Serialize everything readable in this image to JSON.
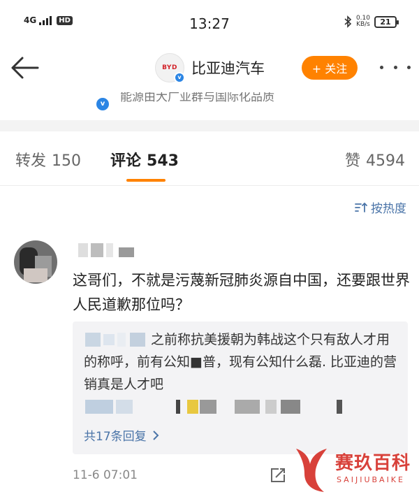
{
  "status_bar": {
    "network": "4G",
    "hd_label": "HD",
    "time": "13:27",
    "speed_value": "0.10",
    "speed_unit": "KB/s",
    "battery": "21"
  },
  "nav": {
    "brand_logo_text": "BYD",
    "brand_name": "比亚迪汽车",
    "follow_label": "+ 关注",
    "verified_mark": "v"
  },
  "cutoff": {
    "text": "能源由大广亚群与国际化品质"
  },
  "tabs": [
    {
      "label": "转发",
      "count": "150"
    },
    {
      "label": "评论",
      "count": "543",
      "active": true
    },
    {
      "label": "赞",
      "count": "4594"
    }
  ],
  "sort": {
    "label": "按热度",
    "icon": "sort-lines-icon"
  },
  "comment": {
    "text": "这哥们，不就是污蔑新冠肺炎源自中国，还要跟世界人民道歉那位吗？",
    "reply": {
      "text": "之前称抗美援朝为韩战这个只有敌人才用的称呼，前有公知■普，现有公知什么磊. 比亚迪的营销真是人才吧"
    },
    "more_replies_label": "共17条回复",
    "timestamp": "11-6 07:01"
  },
  "watermark": {
    "name": "赛玖百科",
    "sub": "SAIJIUBAIKE"
  },
  "colors": {
    "accent": "#ff8200",
    "link": "#4a74a8",
    "verified": "#2b85e4",
    "watermark": "#d8413a"
  }
}
